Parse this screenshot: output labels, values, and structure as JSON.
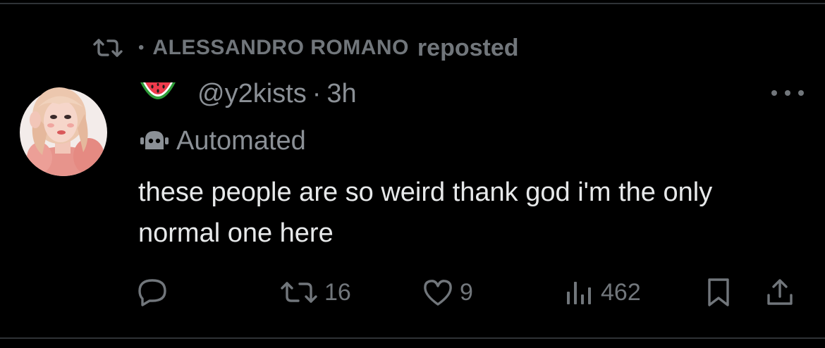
{
  "repost_context": {
    "reposter_name": "ALESSANDRO ROMANO",
    "action_text": "reposted",
    "separator": "•"
  },
  "post": {
    "display_name_icon": "watermelon-emoji",
    "handle": "@y2kists",
    "separator": "·",
    "time": "3h",
    "automated_label": "Automated",
    "text": "these people are so weird thank god i'm the only normal one here"
  },
  "actions": {
    "reply": {
      "icon": "reply-icon"
    },
    "repost": {
      "icon": "repost-icon",
      "count": "16"
    },
    "like": {
      "icon": "heart-icon",
      "count": "9"
    },
    "views": {
      "icon": "views-icon",
      "count": "462"
    },
    "bookmark": {
      "icon": "bookmark-icon"
    },
    "share": {
      "icon": "share-icon"
    }
  },
  "colors": {
    "background": "#000000",
    "primary_text": "#e7e9ea",
    "secondary_text": "#71767b",
    "divider": "#2f3336"
  }
}
